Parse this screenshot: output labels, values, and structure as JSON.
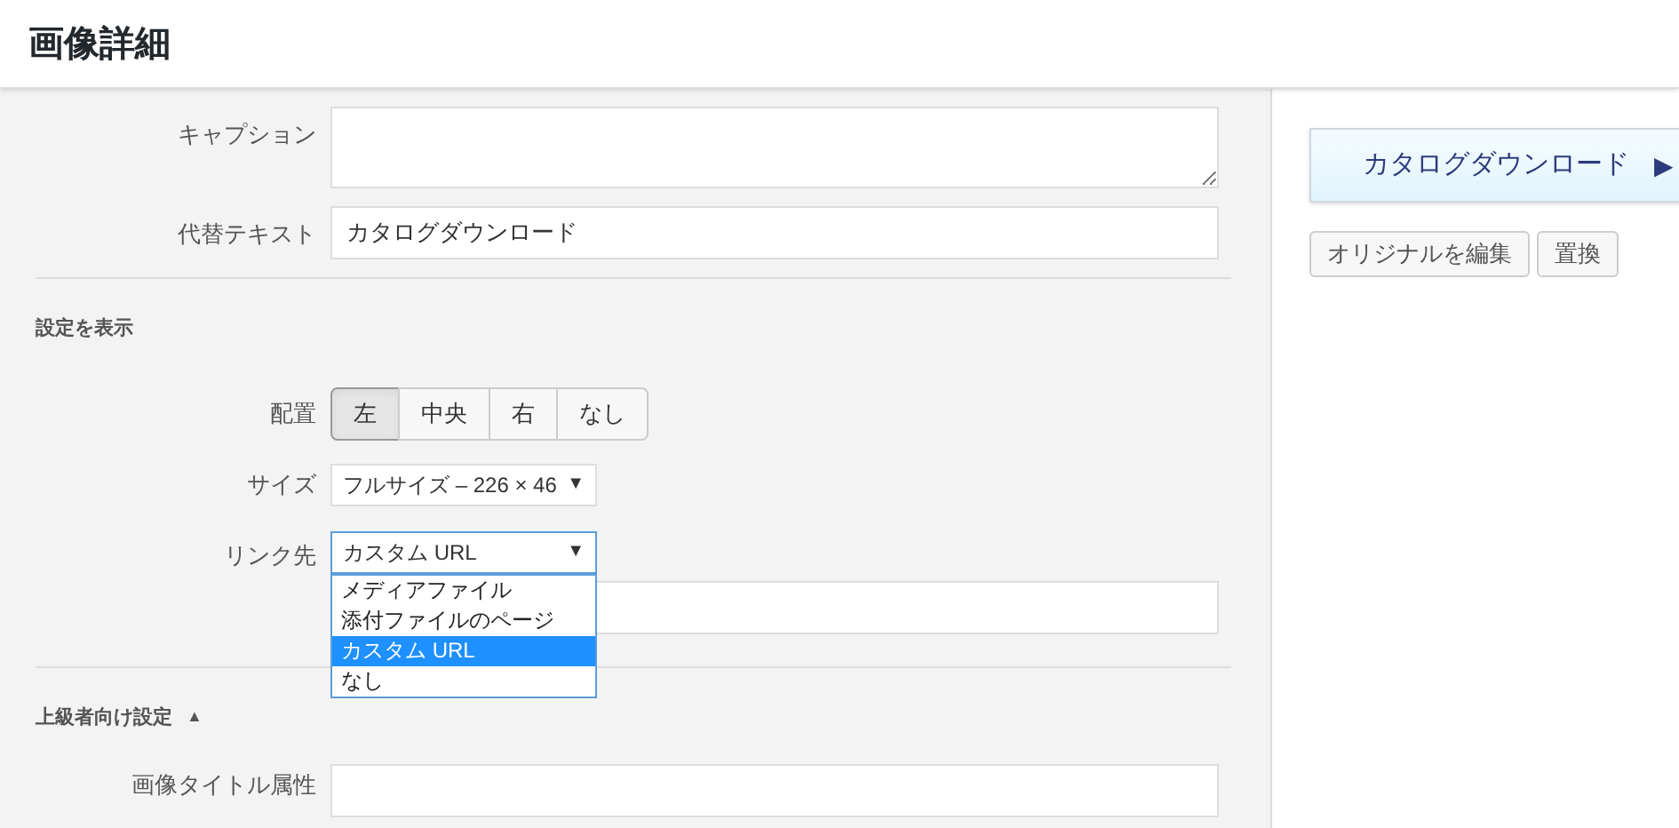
{
  "header": {
    "title": "画像詳細"
  },
  "fields": [
    {
      "kind": "textarea",
      "label": "キャプション"
    },
    {
      "kind": "text",
      "label": "代替テキスト",
      "value": "カタログダウンロード"
    }
  ],
  "display_settings": {
    "heading": "設定を表示",
    "alignment": {
      "label": "配置",
      "options": [
        {
          "label": "左",
          "selected": true
        },
        {
          "label": "中央",
          "selected": false
        },
        {
          "label": "右",
          "selected": false
        },
        {
          "label": "なし",
          "selected": false
        }
      ]
    },
    "size": {
      "label": "サイズ",
      "value": "フルサイズ – 226 × 46",
      "arrow": "▼"
    },
    "link": {
      "label": "リンク先",
      "value": "カスタム URL",
      "arrow": "▼",
      "expanded": true,
      "options": [
        {
          "label": "メディアファイル",
          "selected": false
        },
        {
          "label": "添付ファイルのページ",
          "selected": false
        },
        {
          "label": "カスタム URL",
          "selected": true
        },
        {
          "label": "なし",
          "selected": false
        }
      ]
    }
  },
  "advanced": {
    "heading": "上級者向け設定",
    "toggle": "▲",
    "fields": [
      {
        "label": "画像タイトル属性"
      }
    ]
  },
  "preview": {
    "text": "カタログダウンロード",
    "arrow": "▶"
  },
  "actions": [
    "オリジナルを編集",
    "置換"
  ]
}
